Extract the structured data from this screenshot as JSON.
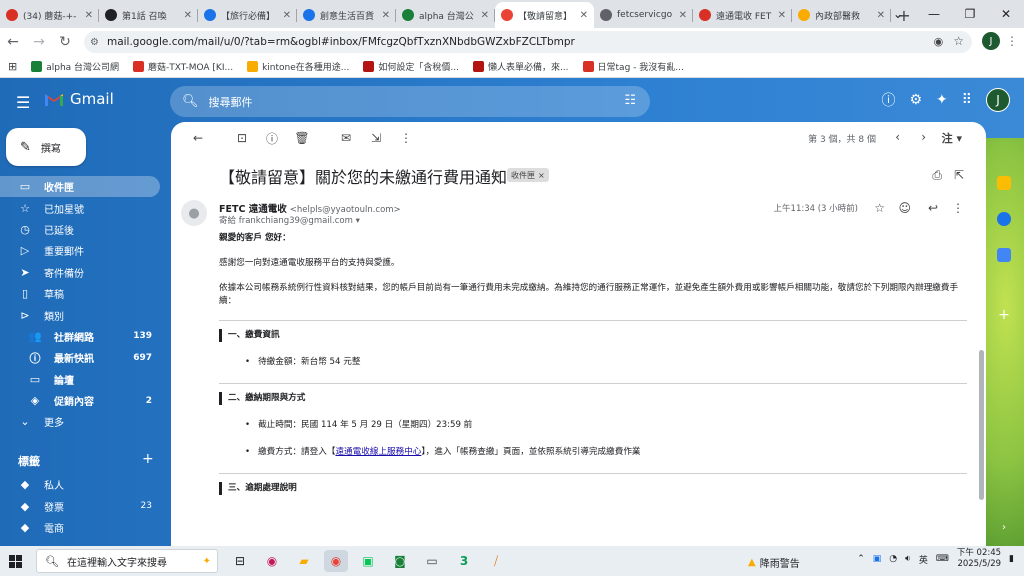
{
  "browser": {
    "tabs": [
      {
        "label": "(34) 蘑菇-+-",
        "color": "#d93025",
        "active": false
      },
      {
        "label": "第1話 召喚",
        "color": "#202124",
        "active": false
      },
      {
        "label": "【旅行必備】",
        "color": "#1a73e8",
        "active": false
      },
      {
        "label": "創意生活百貨",
        "color": "#1a73e8",
        "active": false
      },
      {
        "label": "alpha 台灣公",
        "color": "#188038",
        "active": false
      },
      {
        "label": "【敬請留意】",
        "color": "#ea4335",
        "active": true
      },
      {
        "label": "fetcservicgo",
        "color": "#5f6368",
        "active": false
      },
      {
        "label": "遠通電收 FET",
        "color": "#d93025",
        "active": false
      },
      {
        "label": "內政部醫救",
        "color": "#f9ab00",
        "active": false
      }
    ],
    "new_tab": "+",
    "url": "mail.google.com/mail/u/0/?tab=rm&ogbl#inbox/FMfcgzQbfTxznXNbdbGWZxbFZCLTbmpr",
    "profile_initial": "J",
    "bookmarks": [
      {
        "label": "alpha 台灣公司網",
        "color": "#188038"
      },
      {
        "label": "蘑菇-TXT-MOA [KI...",
        "color": "#d93025"
      },
      {
        "label": "kintone在各種用途...",
        "color": "#f9ab00"
      },
      {
        "label": "如何設定「含稅價...",
        "color": "#b31412"
      },
      {
        "label": "懶人表單必備，來...",
        "color": "#b31412"
      },
      {
        "label": "日常tag - 我沒有亂...",
        "color": "#d93025"
      }
    ]
  },
  "gmail": {
    "app_name": "Gmail",
    "search_placeholder": "搜尋郵件",
    "avatar_initial": "J",
    "compose_label": "撰寫",
    "nav": [
      {
        "label": "收件匣",
        "icon": "▭",
        "count": "",
        "active": true,
        "sub": false
      },
      {
        "label": "已加星號",
        "icon": "☆",
        "count": "",
        "active": false,
        "sub": false
      },
      {
        "label": "已延後",
        "icon": "◷",
        "count": "",
        "active": false,
        "sub": false
      },
      {
        "label": "重要郵件",
        "icon": "▷",
        "count": "",
        "active": false,
        "sub": false
      },
      {
        "label": "寄件備份",
        "icon": "➤",
        "count": "",
        "active": false,
        "sub": false
      },
      {
        "label": "草稿",
        "icon": "▯",
        "count": "",
        "active": false,
        "sub": false
      },
      {
        "label": "類別",
        "icon": "⊳",
        "count": "",
        "active": false,
        "sub": false
      },
      {
        "label": "社群網路",
        "icon": "👥",
        "count": "139",
        "active": false,
        "sub": true
      },
      {
        "label": "最新快訊",
        "icon": "ⓘ",
        "count": "697",
        "active": false,
        "sub": true
      },
      {
        "label": "論壇",
        "icon": "▭",
        "count": "",
        "active": false,
        "sub": true
      },
      {
        "label": "促銷內容",
        "icon": "◈",
        "count": "2",
        "active": false,
        "sub": true
      },
      {
        "label": "更多",
        "icon": "⌄",
        "count": "",
        "active": false,
        "sub": false
      }
    ],
    "labels_title": "標籤",
    "labels": [
      {
        "label": "私人",
        "count": ""
      },
      {
        "label": "發票",
        "count": "23"
      },
      {
        "label": "電商",
        "count": ""
      }
    ],
    "pager": "第 3 個，共 8 個",
    "lang_button": "注"
  },
  "email": {
    "subject": "【敬請留意】關於您的未繳通行費用通知",
    "chip": "收件匣",
    "sender_name": "FETC 遠通電收",
    "sender_email": "<helpls@yyaotouln.com>",
    "to": "寄給 frankchiang39@gmail.com",
    "time": "上午11:34 (3 小時前)",
    "greeting": "親愛的客戶 您好：",
    "para1": "感謝您一向對遠通電收服務平台的支持與愛護。",
    "para2": "依據本公司帳務系統例行性資料核對結果，您的帳戶目前尚有一筆通行費用未完成繳納。為維持您的通行服務正常運作，並避免產生額外費用或影響帳戶相關功能，敬請您於下列期限內辦理繳費手續：",
    "sec1": "一、繳費資訊",
    "amount": "待繳金額：新台幣 54 元整",
    "sec2": "二、繳納期限與方式",
    "deadline": "截止時間：民國 114 年 5 月 29 日（星期四）23:59 前",
    "method_pre": "繳費方式：請登入【",
    "method_link": "遠通電收線上服務中心",
    "method_post": "】，進入「帳務查繳」頁面，並依照系統引導完成繳費作業",
    "sec3": "三、逾期處理說明"
  },
  "taskbar": {
    "search_placeholder": "在這裡輸入文字來搜尋",
    "weather": "降雨警告",
    "ime": "英",
    "time": "下午 02:45",
    "date": "2025/5/29"
  }
}
